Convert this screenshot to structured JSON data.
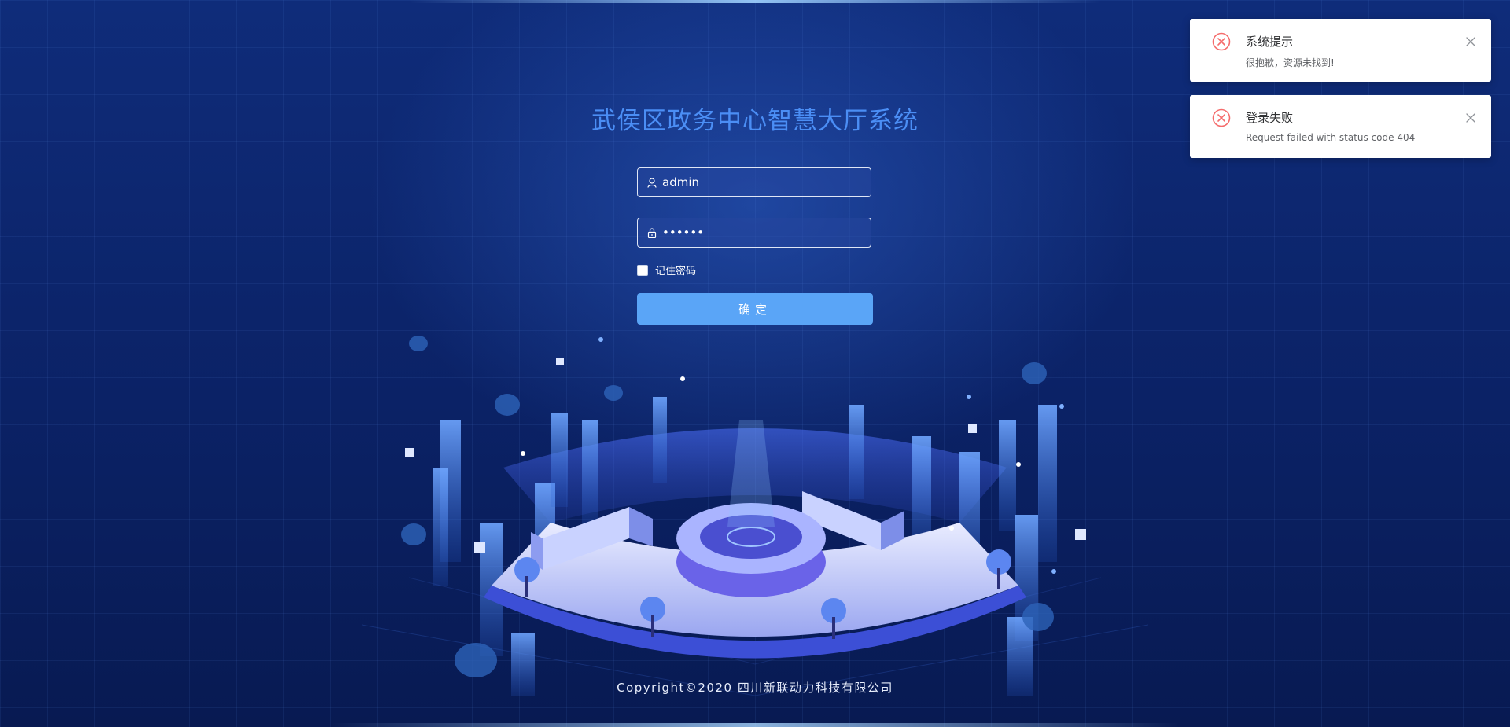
{
  "app": {
    "title": "武侯区政务中心智慧大厅系统",
    "copyright": "Copyright©2020 四川新联动力科技有限公司"
  },
  "login_form": {
    "username_value": "admin",
    "password_value": "••••••",
    "remember_label": "记住密码",
    "remember_checked": false,
    "submit_label": "确定"
  },
  "notifications": [
    {
      "title": "系统提示",
      "message": "很抱歉，资源未找到!",
      "icon": "error-circle-icon"
    },
    {
      "title": "登录失败",
      "message": "Request failed with status code 404",
      "icon": "error-circle-icon"
    }
  ],
  "colors": {
    "title": "#4b8ef5",
    "button": "#5aa5f7",
    "error": "#f56c6c",
    "background": "#0f2c7a"
  },
  "icons": {
    "username": "user-icon",
    "password": "lock-icon",
    "close": "close-icon"
  }
}
